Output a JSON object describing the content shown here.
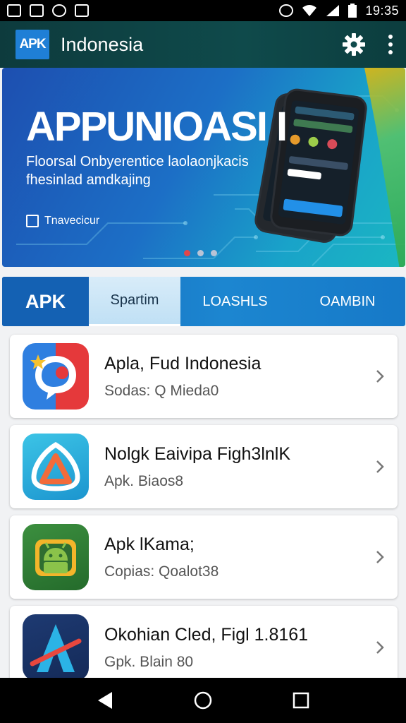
{
  "statusbar": {
    "time": "19:35"
  },
  "appbar": {
    "logo_text": "APK",
    "title": "Indonesia"
  },
  "banner": {
    "title": "APPUNIOASI I",
    "subtitle_line1": "Floorsal Onbyerentice laolaonjkacis",
    "subtitle_line2": "fhesinlad amdkajing",
    "badge_text": "Tnavecicur",
    "page_count": 3,
    "active_page": 1
  },
  "tabs": [
    {
      "label": "APK"
    },
    {
      "label": "Spartim"
    },
    {
      "label": "LOASHLS"
    },
    {
      "label": "OAMBIN"
    }
  ],
  "apps": [
    {
      "title": "Apla, Fud  Indonesia",
      "subtitle": "Sodas: Q Mieda0",
      "icon": "chat-bubble-icon"
    },
    {
      "title": "Nolgk Eaivipa Figh3lnlK",
      "subtitle": "Apk. Biaos8",
      "icon": "triangle-logo-icon"
    },
    {
      "title": "Apk lKama;",
      "subtitle": "Copias: Qoalot38",
      "icon": "android-icon"
    },
    {
      "title": "Okohian Cled, Figl 1.8161",
      "subtitle": "Gpk. Blain 80",
      "icon": "a-logo-icon"
    }
  ],
  "colors": {
    "appbar": "#0f4a4b",
    "tab_bar": "#1c86d0",
    "active_tab": "#d8ecf9",
    "accent_red": "#e2464a"
  }
}
